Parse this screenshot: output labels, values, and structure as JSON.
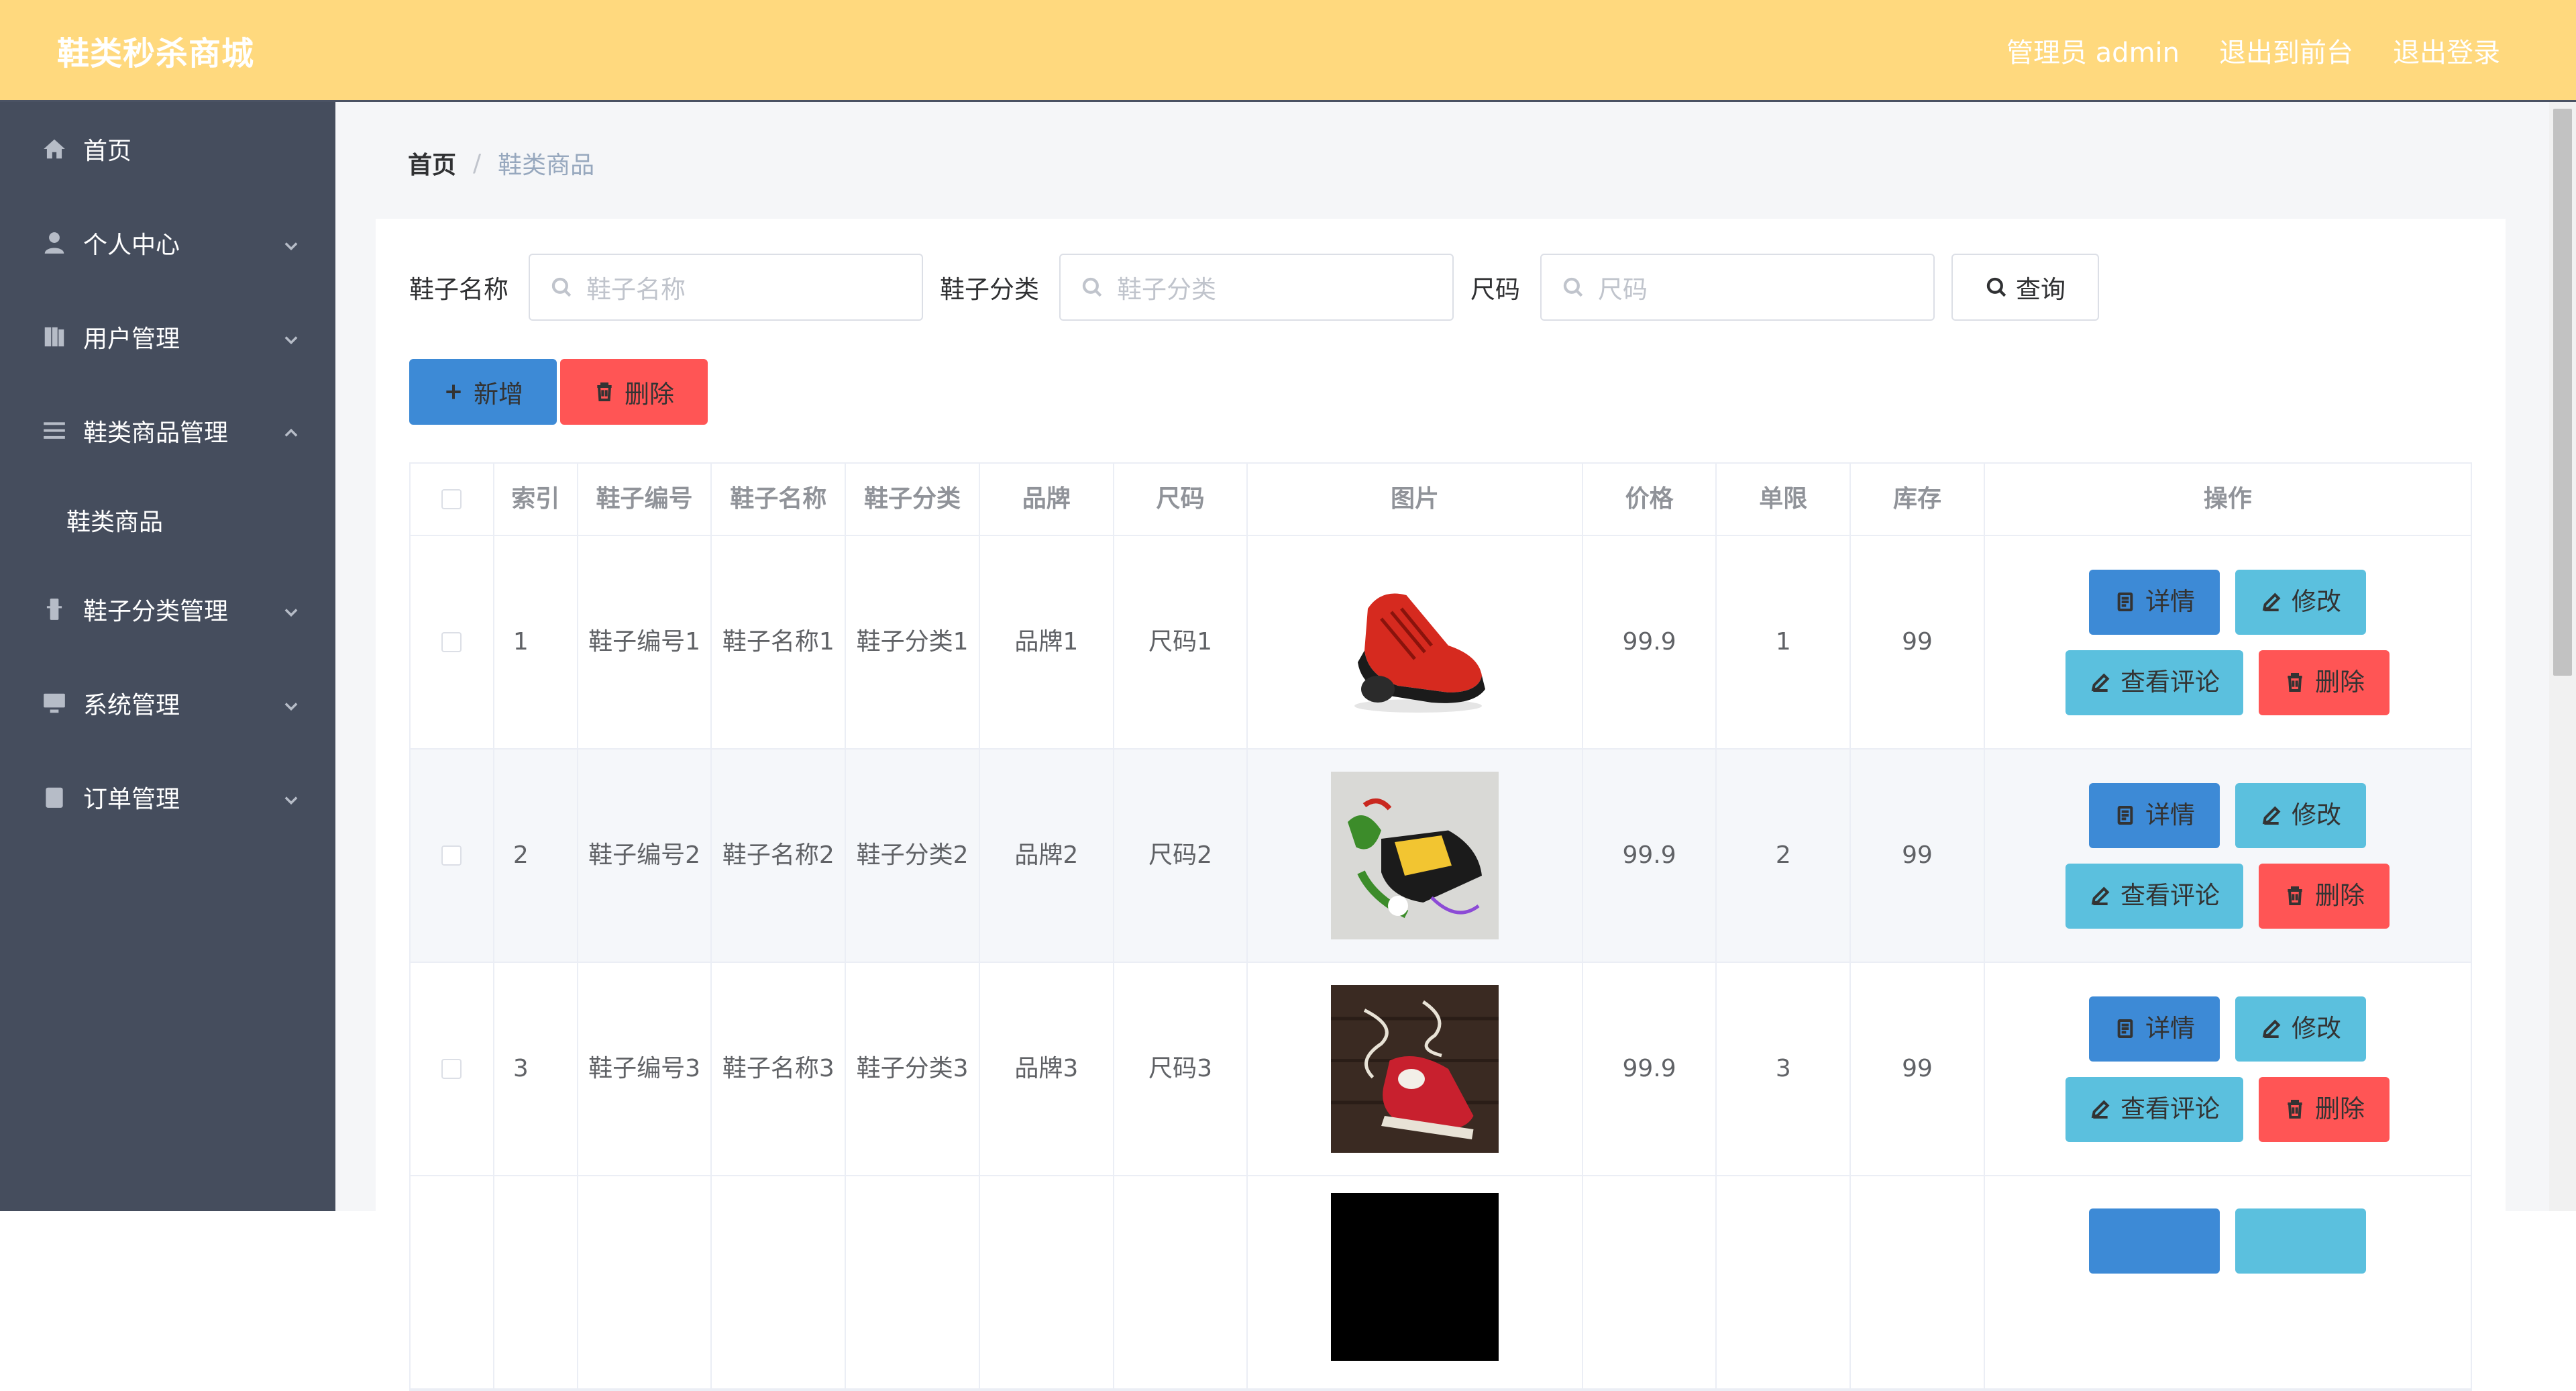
{
  "header": {
    "brand": "鞋类秒杀商城",
    "admin_label": "管理员 admin",
    "to_front": "退出到前台",
    "logout": "退出登录"
  },
  "sidebar": {
    "items": [
      {
        "label": "首页",
        "icon": "home-icon"
      },
      {
        "label": "个人中心",
        "icon": "user-icon"
      },
      {
        "label": "用户管理",
        "icon": "book-icon"
      },
      {
        "label": "鞋类商品管理",
        "icon": "list-icon"
      },
      {
        "label": "鞋子分类管理",
        "icon": "tower-icon"
      },
      {
        "label": "系统管理",
        "icon": "monitor-icon"
      },
      {
        "label": "订单管理",
        "icon": "clipboard-icon"
      }
    ],
    "sub_item": "鞋类商品"
  },
  "breadcrumb": {
    "home": "首页",
    "sep": "/",
    "current": "鞋类商品"
  },
  "search": {
    "name_label": "鞋子名称",
    "name_placeholder": "鞋子名称",
    "category_label": "鞋子分类",
    "category_placeholder": "鞋子分类",
    "size_label": "尺码",
    "size_placeholder": "尺码",
    "query": "查询"
  },
  "actions": {
    "add": "新增",
    "delete": "删除"
  },
  "table": {
    "headers": [
      "索引",
      "鞋子编号",
      "鞋子名称",
      "鞋子分类",
      "品牌",
      "尺码",
      "图片",
      "价格",
      "单限",
      "库存",
      "操作"
    ],
    "rows": [
      {
        "index": "1",
        "code": "鞋子编号1",
        "name": "鞋子名称1",
        "category": "鞋子分类1",
        "brand": "品牌1",
        "size": "尺码1",
        "price": "99.9",
        "limit": "1",
        "stock": "99"
      },
      {
        "index": "2",
        "code": "鞋子编号2",
        "name": "鞋子名称2",
        "category": "鞋子分类2",
        "brand": "品牌2",
        "size": "尺码2",
        "price": "99.9",
        "limit": "2",
        "stock": "99"
      },
      {
        "index": "3",
        "code": "鞋子编号3",
        "name": "鞋子名称3",
        "category": "鞋子分类3",
        "brand": "品牌3",
        "size": "尺码3",
        "price": "99.9",
        "limit": "3",
        "stock": "99"
      }
    ],
    "ops": {
      "detail": "详情",
      "edit": "修改",
      "comment": "查看评论",
      "delete": "删除"
    }
  },
  "colors": {
    "header_bg": "#ffd97e",
    "sidebar_bg": "#454d5d",
    "primary": "#3d8ad6",
    "info": "#5bc0de",
    "danger": "#ff5555"
  }
}
